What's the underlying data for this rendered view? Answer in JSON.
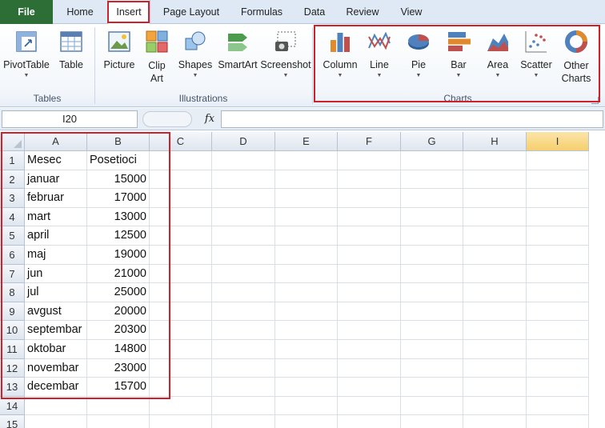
{
  "tabs": [
    "File",
    "Home",
    "Insert",
    "Page Layout",
    "Formulas",
    "Data",
    "Review",
    "View"
  ],
  "ribbon": {
    "groups": {
      "tables": {
        "label": "Tables",
        "items": [
          {
            "label": "PivotTable",
            "icon": "pivottable-icon",
            "dropdown": true
          },
          {
            "label": "Table",
            "icon": "table-icon",
            "dropdown": false
          }
        ]
      },
      "illustrations": {
        "label": "Illustrations",
        "items": [
          {
            "label": "Picture",
            "icon": "picture-icon",
            "dropdown": false
          },
          {
            "label": "Clip Art",
            "icon": "clipart-icon",
            "dropdown": false
          },
          {
            "label": "Shapes",
            "icon": "shapes-icon",
            "dropdown": true
          },
          {
            "label": "SmartArt",
            "icon": "smartart-icon",
            "dropdown": false
          },
          {
            "label": "Screenshot",
            "icon": "screenshot-icon",
            "dropdown": true
          }
        ]
      },
      "charts": {
        "label": "Charts",
        "items": [
          {
            "label": "Column",
            "icon": "column-chart-icon",
            "dropdown": true
          },
          {
            "label": "Line",
            "icon": "line-chart-icon",
            "dropdown": true
          },
          {
            "label": "Pie",
            "icon": "pie-chart-icon",
            "dropdown": true
          },
          {
            "label": "Bar",
            "icon": "bar-chart-icon",
            "dropdown": true
          },
          {
            "label": "Area",
            "icon": "area-chart-icon",
            "dropdown": true
          },
          {
            "label": "Scatter",
            "icon": "scatter-chart-icon",
            "dropdown": true
          },
          {
            "label": "Other Charts",
            "icon": "other-charts-icon",
            "dropdown": true
          }
        ]
      }
    }
  },
  "formula_bar": {
    "name_box": "I20",
    "fx": "fx",
    "value": ""
  },
  "sheet": {
    "columns": [
      "A",
      "B",
      "C",
      "D",
      "E",
      "F",
      "G",
      "H",
      "I"
    ],
    "active_column": "I",
    "rows": [
      "1",
      "2",
      "3",
      "4",
      "5",
      "6",
      "7",
      "8",
      "9",
      "10",
      "11",
      "12",
      "13",
      "14",
      "15"
    ],
    "data": [
      [
        "Mesec",
        "Posetioci"
      ],
      [
        "januar",
        "15000"
      ],
      [
        "februar",
        "17000"
      ],
      [
        "mart",
        "13000"
      ],
      [
        "april",
        "12500"
      ],
      [
        "maj",
        "19000"
      ],
      [
        "jun",
        "21000"
      ],
      [
        "jul",
        "25000"
      ],
      [
        "avgust",
        "20000"
      ],
      [
        "septembar",
        "20300"
      ],
      [
        "oktobar",
        "14800"
      ],
      [
        "novembar",
        "23000"
      ],
      [
        "decembar",
        "15700"
      ]
    ]
  },
  "colors": {
    "file_tab": "#2c6e35",
    "highlight": "#d0202a",
    "active_header": "#f6cf6d"
  }
}
